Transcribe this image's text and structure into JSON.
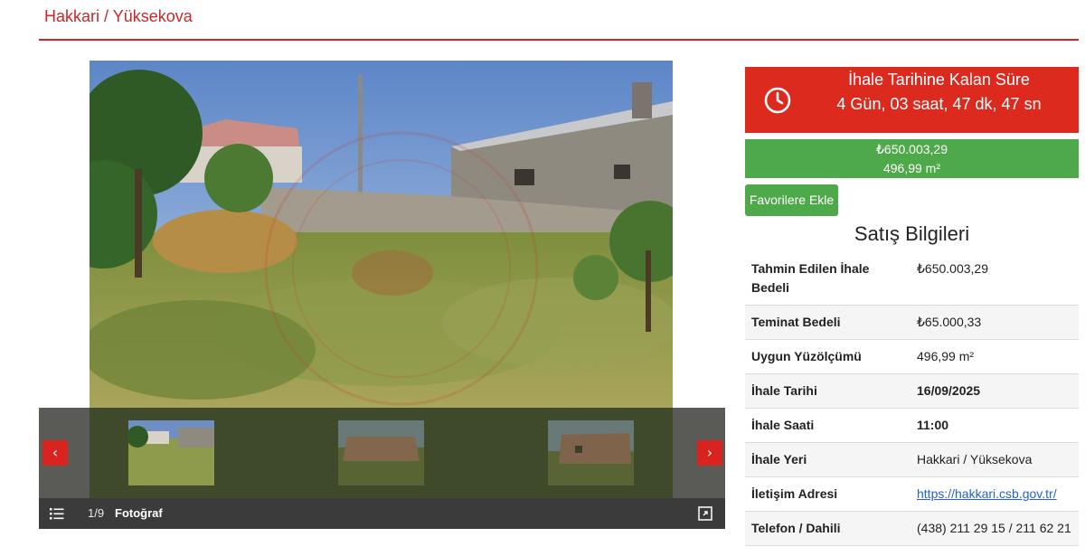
{
  "header": {
    "title": "Hakkari / Yüksekova"
  },
  "gallery": {
    "counter": "1/9",
    "counter_label": "Fotoğraf",
    "prev_label": "‹",
    "next_label": "›"
  },
  "countdown": {
    "label": "İhale Tarihine Kalan Süre",
    "value": "4 Gün, 03 saat, 47 dk, 47 sn"
  },
  "price": {
    "amount": "₺650.003,29",
    "area": "496,99 m²"
  },
  "favorite_button": "Favorilere Ekle",
  "sale_info": {
    "title": "Satış Bilgileri",
    "rows": [
      {
        "key": "Tahmin Edilen İhale Bedeli",
        "value": "₺650.003,29"
      },
      {
        "key": "Teminat Bedeli",
        "value": "₺65.000,33"
      },
      {
        "key": "Uygun Yüzölçümü",
        "value": "496,99 m²"
      },
      {
        "key": "İhale Tarihi",
        "value": "16/09/2025"
      },
      {
        "key": "İhale Saati",
        "value": "11:00"
      },
      {
        "key": "İhale Yeri",
        "value": "Hakkari / Yüksekova"
      },
      {
        "key": "İletişim Adresi",
        "value": "https://hakkari.csb.gov.tr/"
      },
      {
        "key": "Telefon / Dahili",
        "value": "(438) 211 29 15 / 211 62 21"
      }
    ]
  },
  "colors": {
    "accent_red": "#dc2a1f",
    "title_red": "#c8282a",
    "green": "#4ea94a",
    "link_blue": "#2563c9"
  },
  "icons": [
    "clock-icon",
    "chevron-left-icon",
    "chevron-right-icon",
    "list-icon",
    "expand-icon"
  ]
}
